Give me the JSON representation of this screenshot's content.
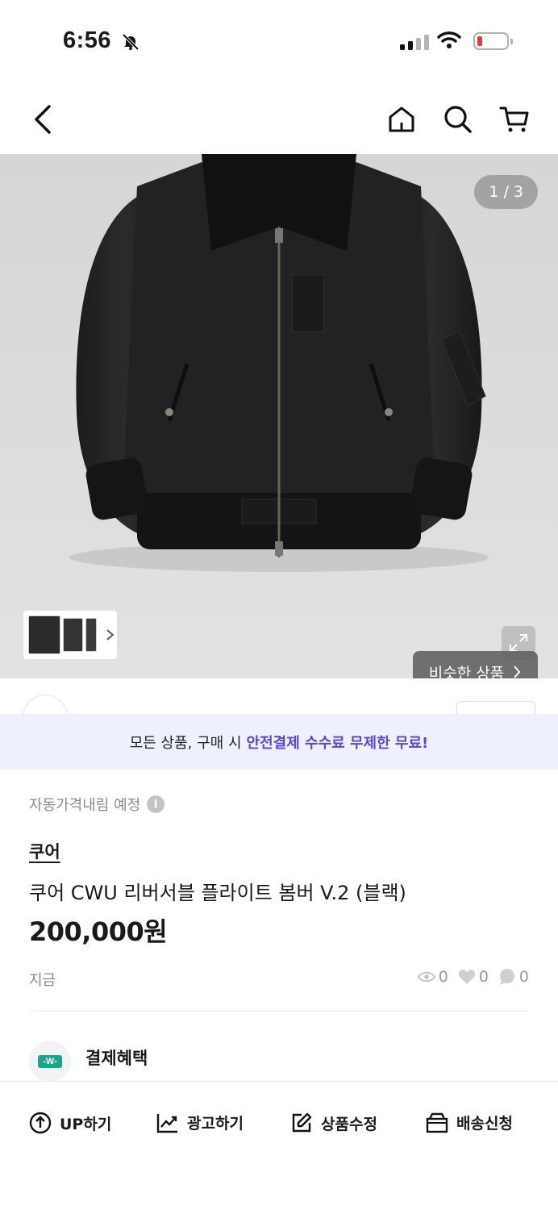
{
  "status_bar": {
    "time": "6:56"
  },
  "gallery": {
    "counter": "1 / 3",
    "similar_label": "비슷한 상품"
  },
  "banner": {
    "text": "모든 상품, 구매 시",
    "highlight": "안전결제 수수료 무제한 무료!"
  },
  "product": {
    "price_drop_label": "자동가격내림 예정",
    "brand": "쿠어",
    "title": "쿠어 CWU 리버서블 플라이트 봄버 V.2 (블랙)",
    "price": "200,000원",
    "posted": "지금",
    "views": "0",
    "likes": "0",
    "chats": "0"
  },
  "benefit": {
    "label": "결제혜택",
    "icon_text": "-W-"
  },
  "actions": [
    {
      "label": "UP하기",
      "icon": "arrow-up-circle-icon"
    },
    {
      "label": "광고하기",
      "icon": "trend-chart-icon"
    },
    {
      "label": "상품수정",
      "icon": "edit-icon"
    },
    {
      "label": "배송신청",
      "icon": "box-icon"
    }
  ],
  "colors": {
    "accent": "#5b46d6",
    "banner_bg": "#eef0fb",
    "benefit_green": "#17a889"
  }
}
